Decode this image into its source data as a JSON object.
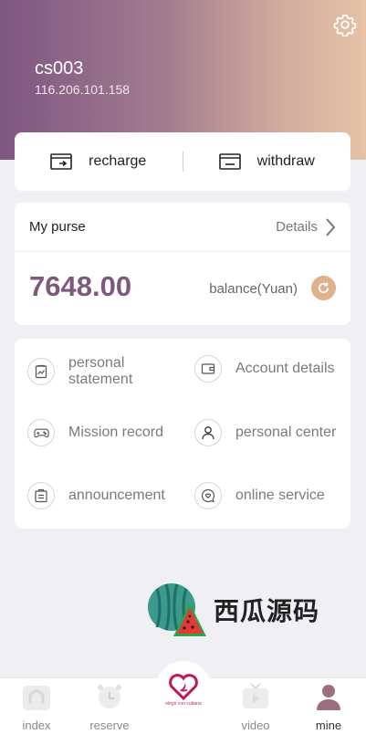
{
  "user": {
    "name": "cs003",
    "ip": "116.206.101.158"
  },
  "actions": {
    "recharge": "recharge",
    "withdraw": "withdraw"
  },
  "purse": {
    "title": "My purse",
    "details": "Details",
    "amount": "7648.00",
    "balance_label": "balance(Yuan)"
  },
  "menu": [
    {
      "label": "personal statement",
      "icon": "chart-icon"
    },
    {
      "label": "Account details",
      "icon": "wallet-icon"
    },
    {
      "label": "Mission record",
      "icon": "gamepad-icon"
    },
    {
      "label": "personal center",
      "icon": "user-icon"
    },
    {
      "label": "announcement",
      "icon": "clipboard-icon"
    },
    {
      "label": "online service",
      "icon": "chat-heart-icon"
    }
  ],
  "watermark": "西瓜源码",
  "center_logo_text": "elegir con cubana",
  "tabs": [
    {
      "label": "index",
      "active": false
    },
    {
      "label": "reserve",
      "active": false
    },
    {
      "label": "video",
      "active": false
    },
    {
      "label": "mine",
      "active": true
    }
  ],
  "colors": {
    "accent": "#7c5a7c",
    "gradient_start": "#7e5682",
    "gradient_end": "#e6c3a6",
    "refresh": "#ddb28c"
  }
}
